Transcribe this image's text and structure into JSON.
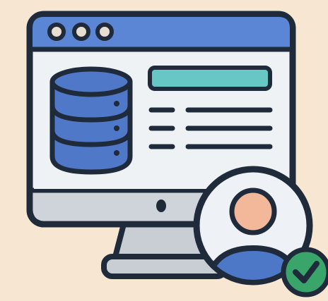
{
  "illustration": {
    "icons": [
      "desktop-monitor-icon",
      "window-dots-icon",
      "database-icon",
      "text-lines-icon",
      "user-avatar-icon",
      "checkmark-badge-icon"
    ],
    "text_line_count": 3,
    "window_dot_count": 3
  },
  "colors": {
    "background": "#f6e6d2",
    "outline": "#1f2a3a",
    "title_bar": "#5b86d6",
    "screen": "#eef2f5",
    "monitor_chin": "#cfd4da",
    "stand": "#c9ced5",
    "database": "#4f78c8",
    "teal_bar": "#67c7c4",
    "window_dot": "#e7ddd1",
    "avatar_ring": "#eef1f6",
    "avatar_face": "#f3b79a",
    "avatar_body": "#4d78c8",
    "check_badge": "#39a56a"
  }
}
